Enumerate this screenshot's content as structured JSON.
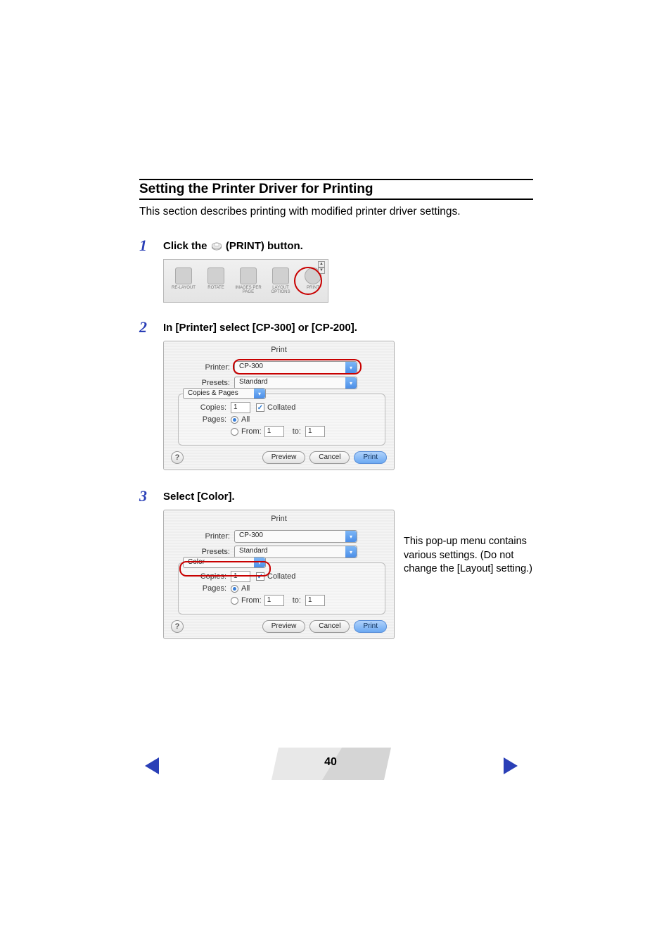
{
  "heading": "Setting the Printer Driver for Printing",
  "intro": "This section describes printing with modified printer driver settings.",
  "steps": {
    "s1": {
      "num": "1",
      "pre": "Click the ",
      "post": " (PRINT) button."
    },
    "s2": {
      "num": "2",
      "text": "In [Printer] select [CP-300] or [CP-200]."
    },
    "s3": {
      "num": "3",
      "text": "Select [Color]."
    }
  },
  "toolbar": {
    "items": [
      "RE-LAYOUT",
      "ROTATE",
      "IMAGES PER PAGE",
      "LAYOUT OPTIONS",
      "PRINT"
    ]
  },
  "dialog": {
    "title": "Print",
    "printer_label": "Printer:",
    "printer_value": "CP-300",
    "presets_label": "Presets:",
    "presets_value": "Standard",
    "section_d2": "Copies & Pages",
    "section_d3": "Color",
    "copies_label": "Copies:",
    "copies_value": "1",
    "collated_label": "Collated",
    "pages_label": "Pages:",
    "all_label": "All",
    "from_label": "From:",
    "from_value": "1",
    "to_label": "to:",
    "to_value": "1",
    "help": "?",
    "preview": "Preview",
    "cancel": "Cancel",
    "print": "Print"
  },
  "sidenote": "This pop-up menu contains various settings. (Do not change the [Layout] setting.)",
  "page_number": "40"
}
